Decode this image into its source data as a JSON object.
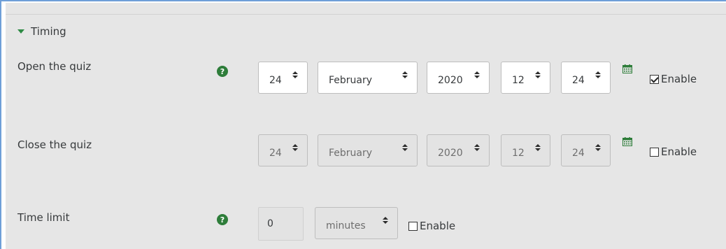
{
  "section": {
    "title": "Timing"
  },
  "open_quiz": {
    "label": "Open the quiz",
    "day": "24",
    "month": "February",
    "year": "2020",
    "hour": "12",
    "minute": "24",
    "enable_label": "Enable",
    "enabled": true
  },
  "close_quiz": {
    "label": "Close the quiz",
    "day": "24",
    "month": "February",
    "year": "2020",
    "hour": "12",
    "minute": "24",
    "enable_label": "Enable",
    "enabled": false
  },
  "time_limit": {
    "label": "Time limit",
    "value": "0",
    "unit": "minutes",
    "enable_label": "Enable",
    "enabled": false
  },
  "colors": {
    "accent_green": "#2e7d3a",
    "panel_bg": "#e6e6e6",
    "frame_blue": "#6f9fd8"
  },
  "icons": {
    "help": "question-circle-icon",
    "calendar": "calendar-icon",
    "section_toggle": "caret-down-icon"
  }
}
